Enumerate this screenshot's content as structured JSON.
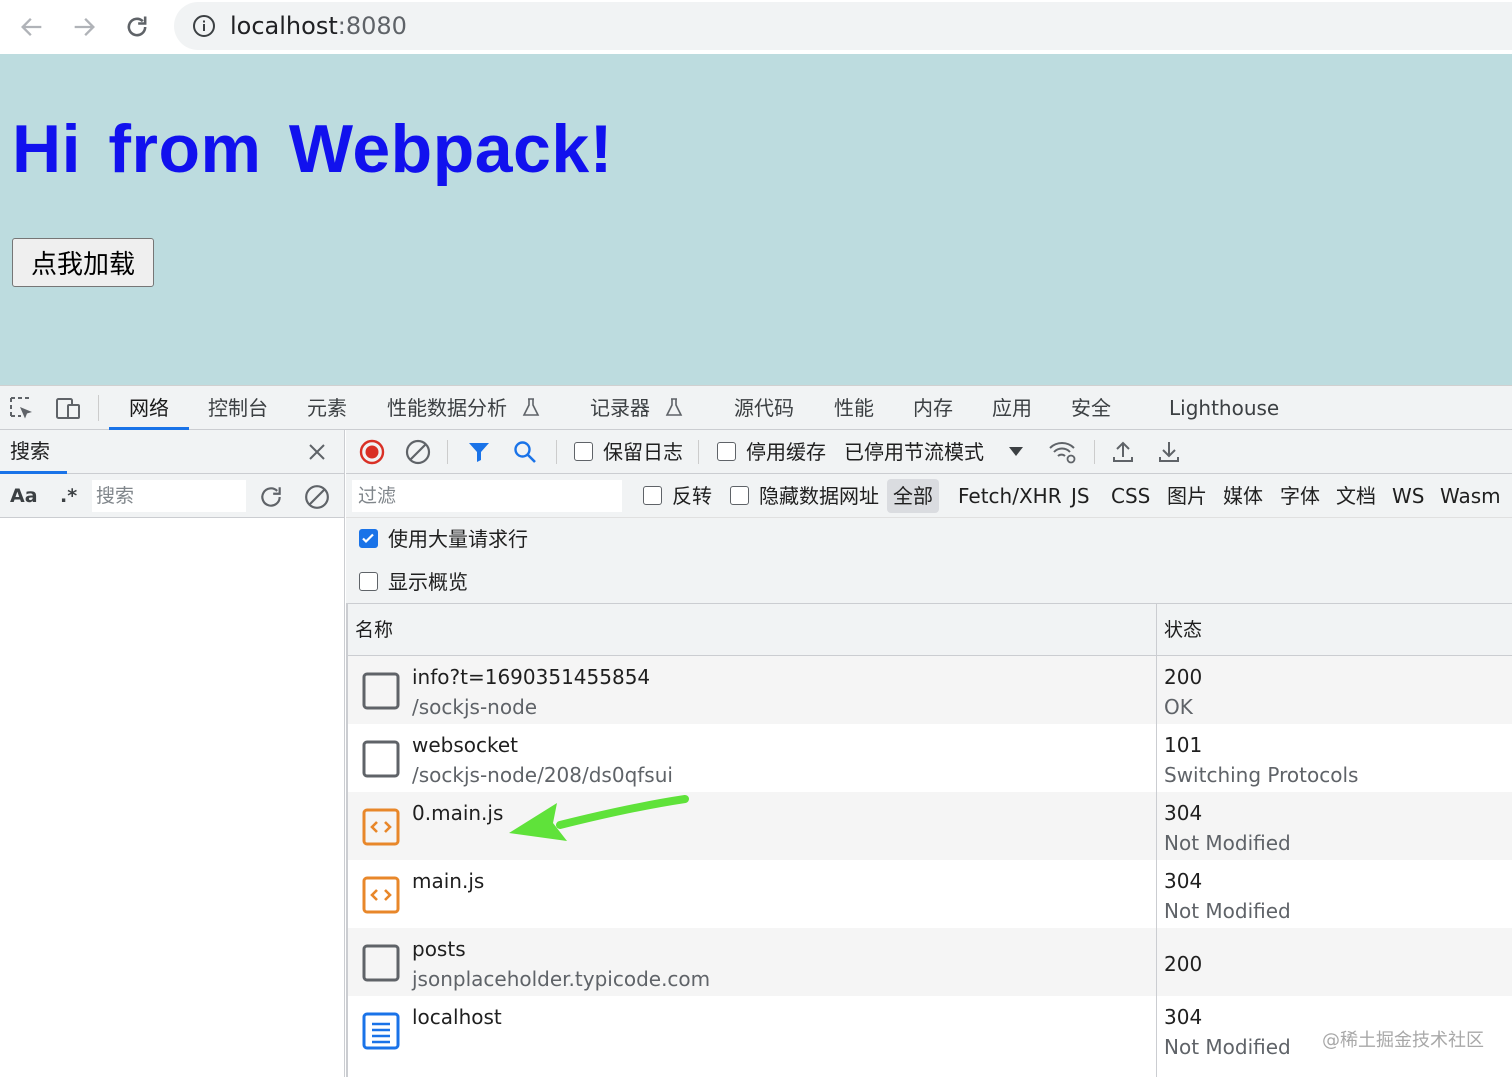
{
  "browser": {
    "url_host": "localhost",
    "url_port": ":8080"
  },
  "page": {
    "heading": "Hi from Webpack!",
    "load_button": "点我加载"
  },
  "devtools": {
    "tabs": [
      {
        "label": "网络",
        "active": true
      },
      {
        "label": "控制台"
      },
      {
        "label": "元素"
      },
      {
        "label": "性能数据分析"
      },
      {
        "label": "记录器"
      },
      {
        "label": "源代码"
      },
      {
        "label": "性能"
      },
      {
        "label": "内存"
      },
      {
        "label": "应用"
      },
      {
        "label": "安全"
      },
      {
        "label": "Lighthouse"
      }
    ],
    "search_pane": {
      "title": "搜索",
      "case_label": "Aa",
      "regex_label": ".*",
      "input_placeholder": "搜索"
    },
    "network": {
      "toolbar": {
        "preserve_log": "保留日志",
        "disable_cache": "停用缓存",
        "throttling": "已停用节流模式"
      },
      "filter": {
        "placeholder": "过滤",
        "invert": "反转",
        "hide_data_urls": "隐藏数据网址",
        "types": [
          "全部",
          "Fetch/XHR",
          "JS",
          "CSS",
          "图片",
          "媒体",
          "字体",
          "文档",
          "WS",
          "Wasm"
        ]
      },
      "options": {
        "large_rows": "使用大量请求行",
        "large_rows_checked": true,
        "show_overview": "显示概览",
        "show_overview_checked": false
      },
      "columns": {
        "name": "名称",
        "status": "状态"
      },
      "requests": [
        {
          "name": "info?t=1690351455854",
          "path": "/sockjs-node",
          "status": "200",
          "status_text": "OK",
          "icon": "blank-file-icon"
        },
        {
          "name": "websocket",
          "path": "/sockjs-node/208/ds0qfsui",
          "status": "101",
          "status_text": "Switching Protocols",
          "icon": "blank-file-icon"
        },
        {
          "name": "0.main.js",
          "path": "",
          "status": "304",
          "status_text": "Not Modified",
          "icon": "script-file-icon"
        },
        {
          "name": "main.js",
          "path": "",
          "status": "304",
          "status_text": "Not Modified",
          "icon": "script-file-icon"
        },
        {
          "name": "posts",
          "path": "jsonplaceholder.typicode.com",
          "status": "200",
          "status_text": "",
          "icon": "blank-file-icon"
        },
        {
          "name": "localhost",
          "path": "",
          "status": "304",
          "status_text": "Not Modified",
          "icon": "document-file-icon"
        }
      ]
    }
  },
  "watermark": "@稀土掘金技术社区",
  "colors": {
    "page_bg": "#bddcdf",
    "heading": "#1111ee",
    "accent": "#1a73e8",
    "script_icon": "#e8872a",
    "arrow": "#5fe23a"
  }
}
